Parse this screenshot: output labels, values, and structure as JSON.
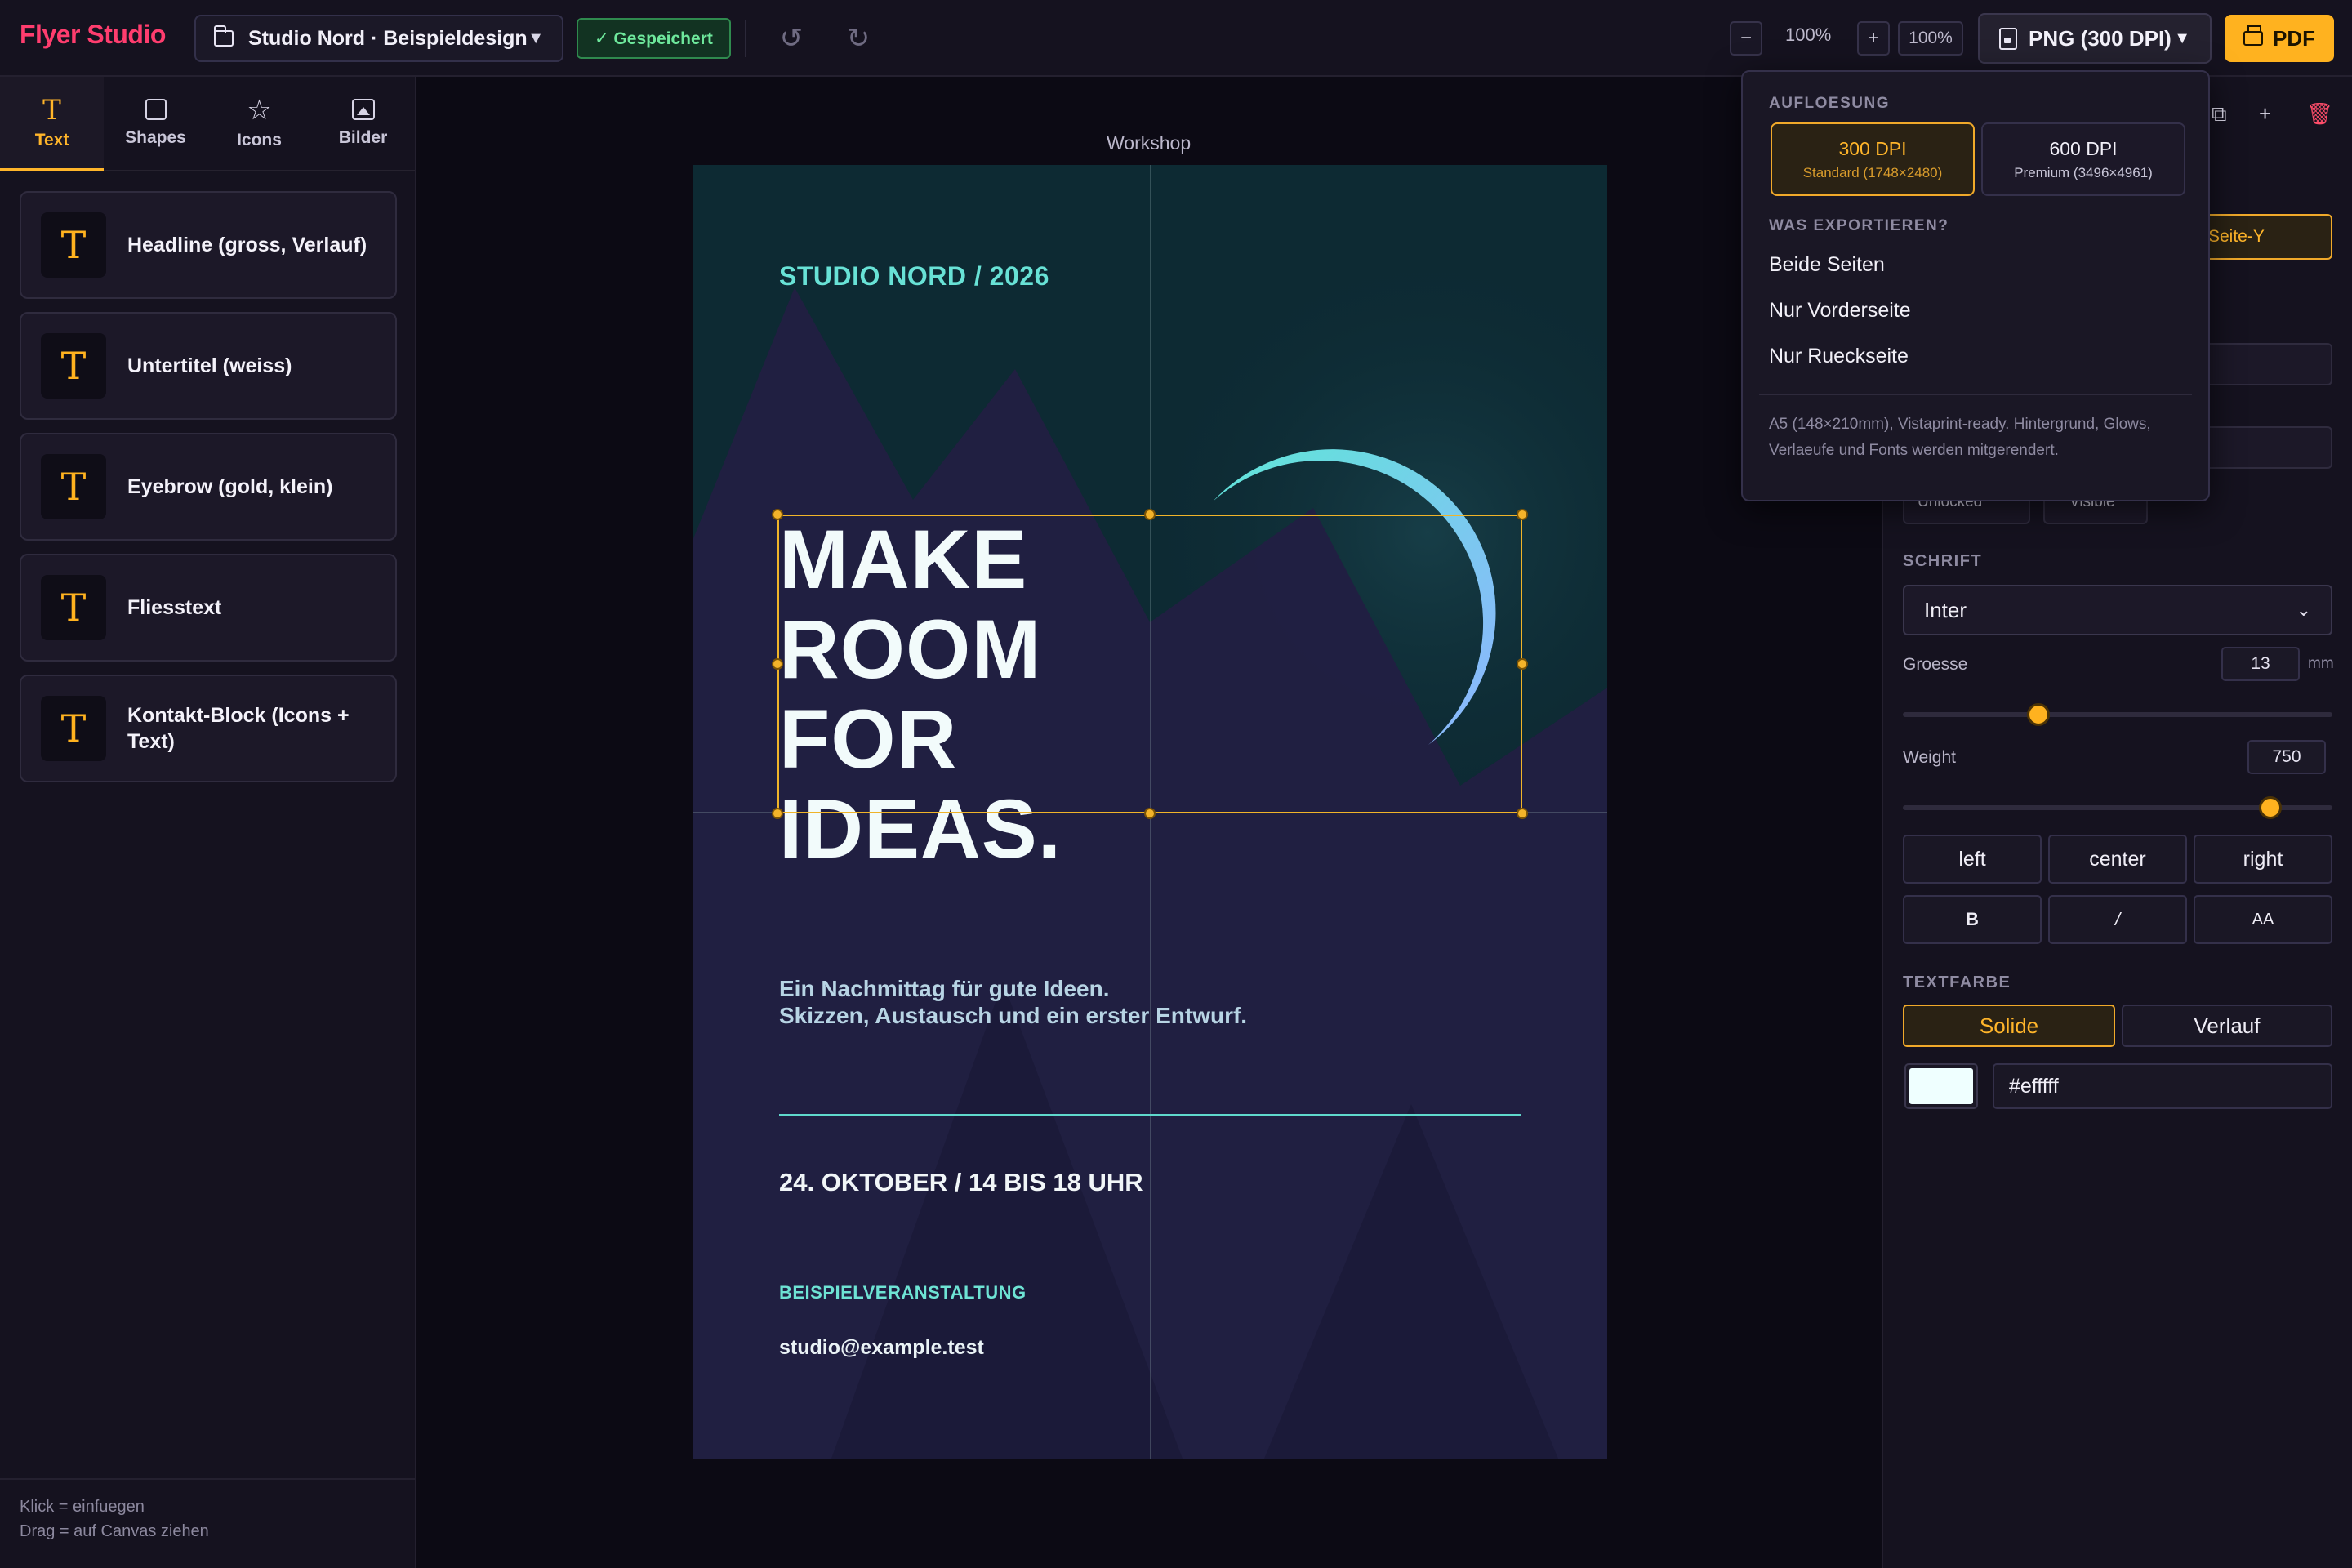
{
  "app": {
    "brand": "Flyer Studio",
    "project_name": "Studio Nord · Beispieldesign",
    "saved_label": "✓ Gespeichert",
    "zoom_value": "100%",
    "zoom_box": "100%",
    "export_format": "PNG (300 DPI)",
    "pdf_label": "PDF",
    "accent_color": "#ffb21f"
  },
  "left": {
    "tabs": [
      {
        "label": "Text",
        "icon": "text-icon"
      },
      {
        "label": "Shapes",
        "icon": "square-icon"
      },
      {
        "label": "Icons",
        "icon": "star-icon"
      },
      {
        "label": "Bilder",
        "icon": "image-icon"
      }
    ],
    "items": [
      {
        "label": "Headline (gross, Verlauf)"
      },
      {
        "label": "Untertitel (weiss)"
      },
      {
        "label": "Eyebrow (gold, klein)"
      },
      {
        "label": "Fliesstext"
      },
      {
        "label": "Kontakt-Block (Icons + Text)"
      }
    ],
    "hint_line1": "Klick = einfuegen",
    "hint_line2": "Drag = auf Canvas ziehen"
  },
  "canvas": {
    "page_title": "Workshop",
    "eyebrow": "STUDIO NORD / 2026",
    "headline_line1": "MAKE",
    "headline_line2": "ROOM FOR",
    "headline_line3": "IDEAS.",
    "sub_line1": "Ein Nachmittag für gute Ideen.",
    "sub_line2": "Skizzen, Austausch und ein erster Entwurf.",
    "date": "24. OKTOBER / 14 BIS 18 UHR",
    "event": "BEISPIELVERANSTALTUNG",
    "email": "studio@example.test",
    "background_color": "#0d2a33"
  },
  "dropdown": {
    "resolution_label": "AUFLOESUNG",
    "dpi_options": [
      {
        "title": "300 DPI",
        "detail": "Standard (1748×2480)",
        "selected": true
      },
      {
        "title": "600 DPI",
        "detail": "Premium (3496×4961)",
        "selected": false
      }
    ],
    "export_label": "WAS EXPORTIEREN?",
    "export_options": [
      "Beide Seiten",
      "Nur Vorderseite",
      "Nur Rueckseite"
    ],
    "note": "A5 (148×210mm), Vistaprint-ready. Hintergrund, Glows, Verlaeufe und Fonts werden mitgerendert."
  },
  "right": {
    "partial_button": "Seite-Y",
    "unlocked_label": "Unlocked",
    "visible_label": "Visible",
    "font_label": "SCHRIFT",
    "font_value": "Inter",
    "size_label": "Groesse",
    "size_value": "13",
    "size_unit": "mm",
    "weight_label": "Weight",
    "weight_value": "750",
    "align": [
      "left",
      "center",
      "right"
    ],
    "style": [
      "B",
      "/",
      "AA"
    ],
    "color_label": "TEXTFARBE",
    "color_modes": [
      "Solide",
      "Verlauf"
    ],
    "color_hex": "#efffff"
  }
}
